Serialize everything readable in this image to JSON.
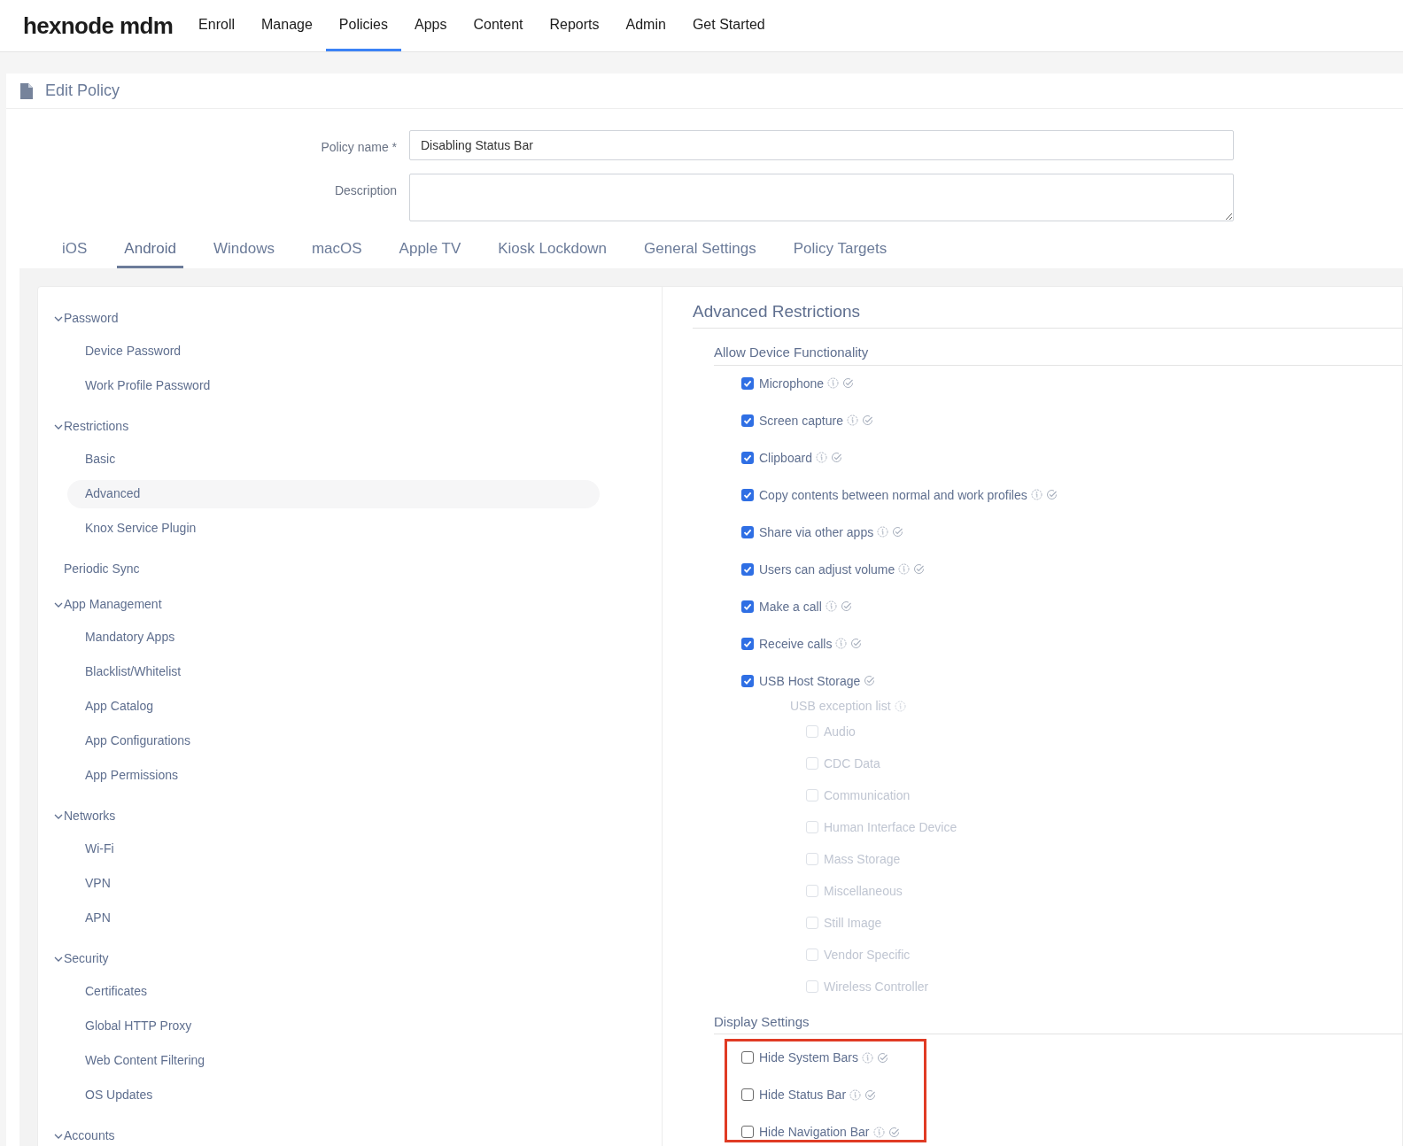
{
  "brand": "hexnode mdm",
  "nav": [
    {
      "label": "Enroll",
      "selected": false
    },
    {
      "label": "Manage",
      "selected": false
    },
    {
      "label": "Policies",
      "selected": true
    },
    {
      "label": "Apps",
      "selected": false
    },
    {
      "label": "Content",
      "selected": false
    },
    {
      "label": "Reports",
      "selected": false
    },
    {
      "label": "Admin",
      "selected": false
    },
    {
      "label": "Get Started",
      "selected": false
    }
  ],
  "page_title": "Edit Policy",
  "form": [
    {
      "label": "Policy name *",
      "kind": "input",
      "value": "Disabling Status Bar"
    },
    {
      "label": "Description",
      "kind": "textarea"
    }
  ],
  "platform_tabs": [
    {
      "label": "iOS",
      "selected": false
    },
    {
      "label": "Android",
      "selected": true
    },
    {
      "label": "Windows",
      "selected": false
    },
    {
      "label": "macOS",
      "selected": false
    },
    {
      "label": "Apple TV",
      "selected": false
    },
    {
      "label": "Kiosk Lockdown",
      "selected": false
    },
    {
      "label": "General Settings",
      "selected": false
    },
    {
      "label": "Policy Targets",
      "selected": false
    }
  ],
  "sidebar": {
    "items": [
      {
        "label": "Password",
        "expanded": true,
        "children": [
          {
            "label": "Device Password",
            "selected": false
          },
          {
            "label": "Work Profile Password",
            "selected": false
          }
        ]
      },
      {
        "label": "Restrictions",
        "expanded": true,
        "children": [
          {
            "label": "Basic",
            "selected": false
          },
          {
            "label": "Advanced",
            "selected": true
          },
          {
            "label": "Knox Service Plugin",
            "selected": false
          }
        ]
      },
      {
        "label": "Periodic Sync"
      },
      {
        "label": "App Management",
        "expanded": true,
        "children": [
          {
            "label": "Mandatory Apps",
            "selected": false
          },
          {
            "label": "Blacklist/Whitelist",
            "selected": false
          },
          {
            "label": "App Catalog",
            "selected": false
          },
          {
            "label": "App Configurations",
            "selected": false
          },
          {
            "label": "App Permissions",
            "selected": false
          }
        ]
      },
      {
        "label": "Networks",
        "expanded": true,
        "children": [
          {
            "label": "Wi-Fi",
            "selected": false
          },
          {
            "label": "VPN",
            "selected": false
          },
          {
            "label": "APN",
            "selected": false
          }
        ]
      },
      {
        "label": "Security",
        "expanded": true,
        "children": [
          {
            "label": "Certificates",
            "selected": false
          },
          {
            "label": "Global HTTP Proxy",
            "selected": false
          },
          {
            "label": "Web Content Filtering",
            "selected": false
          },
          {
            "label": "OS Updates",
            "selected": false
          }
        ]
      },
      {
        "label": "Accounts",
        "expanded": true
      }
    ]
  },
  "panel": {
    "title": "Advanced Restrictions",
    "sections": [
      {
        "title": "Allow Device Functionality",
        "highlighted": false,
        "items": [
          {
            "label": "Microphone",
            "checked": true,
            "info_icon": true
          },
          {
            "label": "Screen capture",
            "checked": true,
            "info_icon": true
          },
          {
            "label": "Clipboard",
            "checked": true,
            "info_icon": true
          },
          {
            "label": "Copy contents between normal and work profiles",
            "checked": true,
            "info_icon": true
          },
          {
            "label": "Share via other apps",
            "checked": true,
            "info_icon": true
          },
          {
            "label": "Users can adjust volume",
            "checked": true,
            "info_icon": true
          },
          {
            "label": "Make a call",
            "checked": true,
            "info_icon": true
          },
          {
            "label": "Receive calls",
            "checked": true,
            "info_icon": true
          },
          {
            "label": "USB Host Storage",
            "checked": true,
            "info_icon": false,
            "sublist": {
              "title": "USB exception list",
              "items": [
                {
                  "label": "Audio",
                  "checked": false,
                  "disabled": true
                },
                {
                  "label": "CDC Data",
                  "checked": false,
                  "disabled": true
                },
                {
                  "label": "Communication",
                  "checked": false,
                  "disabled": true
                },
                {
                  "label": "Human Interface Device",
                  "checked": false,
                  "disabled": true
                },
                {
                  "label": "Mass Storage",
                  "checked": false,
                  "disabled": true
                },
                {
                  "label": "Miscellaneous",
                  "checked": false,
                  "disabled": true
                },
                {
                  "label": "Still Image",
                  "checked": false,
                  "disabled": true
                },
                {
                  "label": "Vendor Specific",
                  "checked": false,
                  "disabled": true
                },
                {
                  "label": "Wireless Controller",
                  "checked": false,
                  "disabled": true
                }
              ]
            }
          }
        ]
      },
      {
        "title": "Display Settings",
        "highlighted": true,
        "items": [
          {
            "label": "Hide System Bars",
            "checked": false,
            "info_icon": true
          },
          {
            "label": "Hide Status Bar",
            "checked": false,
            "info_icon": true
          },
          {
            "label": "Hide Navigation Bar",
            "checked": false,
            "info_icon": true
          }
        ]
      }
    ]
  }
}
